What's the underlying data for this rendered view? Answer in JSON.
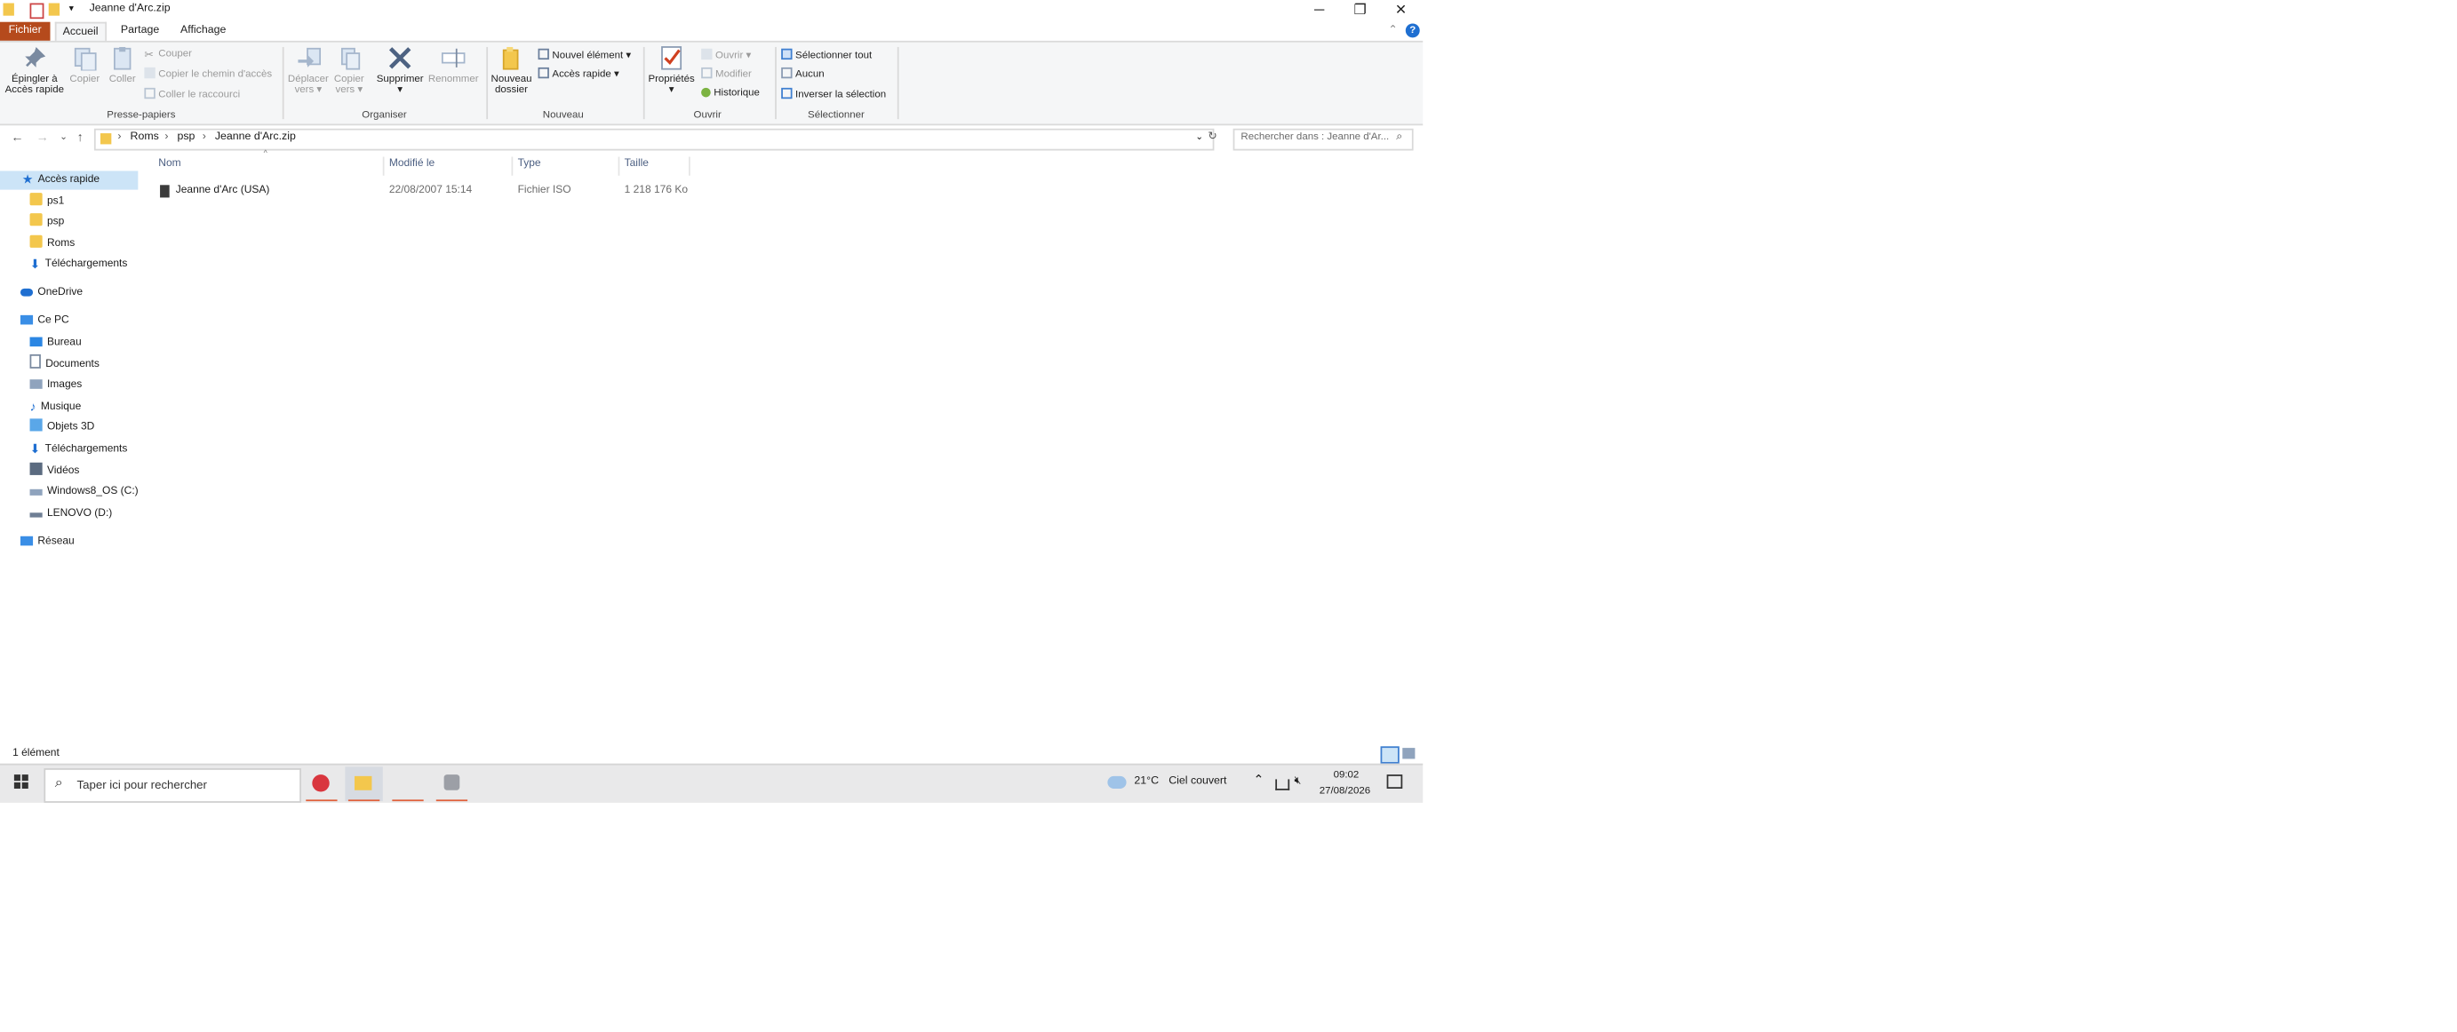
{
  "window": {
    "title": "Jeanne d'Arc.zip",
    "minimize_glyph": "─",
    "restore_glyph": "❐",
    "close_glyph": "✕"
  },
  "tabs": {
    "file": "Fichier",
    "home": "Accueil",
    "share": "Partage",
    "view": "Affichage"
  },
  "ribbon": {
    "clipboard": {
      "pin": "Épingler à",
      "pin2": "Accès rapide",
      "copy": "Copier",
      "paste": "Coller",
      "cut": "Couper",
      "copy_path": "Copier le chemin d'accès",
      "paste_shortcut": "Coller le raccourci",
      "label": "Presse-papiers"
    },
    "organize": {
      "move": "Déplacer",
      "move2": "vers",
      "copyto": "Copier",
      "copyto2": "vers",
      "delete": "Supprimer",
      "rename": "Renommer",
      "label": "Organiser"
    },
    "new": {
      "new_folder": "Nouveau",
      "new_folder2": "dossier",
      "new_item": "Nouvel élément",
      "easy_access": "Accès rapide",
      "label": "Nouveau"
    },
    "open": {
      "properties": "Propriétés",
      "open": "Ouvrir",
      "edit": "Modifier",
      "history": "Historique",
      "label": "Ouvrir"
    },
    "select": {
      "select_all": "Sélectionner tout",
      "select_none": "Aucun",
      "invert": "Inverser la sélection",
      "label": "Sélectionner"
    }
  },
  "address": {
    "crumbs": [
      "Roms",
      "psp",
      "Jeanne d'Arc.zip"
    ],
    "search_placeholder": "Rechercher dans : Jeanne d'Ar..."
  },
  "nav": {
    "quick_access": "Accès rapide",
    "quick_items": [
      "ps1",
      "psp",
      "Roms",
      "Téléchargements"
    ],
    "onedrive": "OneDrive",
    "this_pc": "Ce PC",
    "pc_items": [
      "Bureau",
      "Documents",
      "Images",
      "Musique",
      "Objets 3D",
      "Téléchargements",
      "Vidéos",
      "Windows8_OS (C:)",
      "LENOVO (D:)"
    ],
    "network": "Réseau"
  },
  "columns": {
    "name": "Nom",
    "modified": "Modifié le",
    "type": "Type",
    "size": "Taille"
  },
  "files": [
    {
      "name": "Jeanne d'Arc (USA)",
      "modified": "22/08/2007 15:14",
      "type": "Fichier ISO",
      "size": "1 218 176 Ko"
    }
  ],
  "status": {
    "count": "1 élément"
  },
  "taskbar": {
    "search_placeholder": "Taper ici pour rechercher",
    "weather_temp": "21°C",
    "weather_desc": "Ciel couvert",
    "time": "09:02",
    "date": "27/08/2026"
  },
  "colors": {
    "file_tab": "#b54a1c",
    "selection": "#cce4f7",
    "folder": "#f3c74d",
    "accent_blue": "#1f6fd1"
  }
}
